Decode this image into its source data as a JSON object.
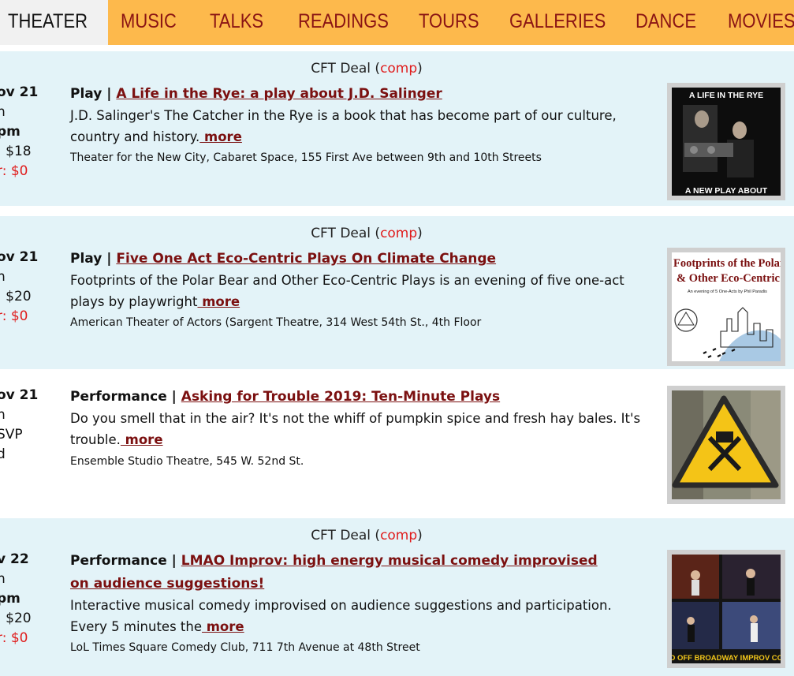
{
  "nav": {
    "tabs": [
      {
        "label": "THEATER",
        "active": true
      },
      {
        "label": "MUSIC"
      },
      {
        "label": "TALKS"
      },
      {
        "label": "READINGS"
      },
      {
        "label": "TOURS"
      },
      {
        "label": "GALLERIES"
      },
      {
        "label": "DANCE"
      },
      {
        "label": "MOVIES"
      }
    ]
  },
  "events": [
    {
      "deal_label": "CFT Deal (",
      "deal_comp": "comp",
      "deal_close": ")",
      "date": "ov 21",
      "line2": "n",
      "time": "pm",
      "price": ": $18",
      "member_price": "r: $0",
      "kind": "Play | ",
      "title": "A Life in the Rye: a play about J.D. Salinger",
      "desc": "J.D. Salinger's The Catcher in the Rye is a book that has become part of our culture, country and history.",
      "more": " more",
      "venue": "Theater for the New City, Cabaret Space, 155 First Ave between 9th and 10th Streets",
      "image_text_top": "A LIFE IN THE RYE",
      "image_text_bottom": "A NEW PLAY ABOUT"
    },
    {
      "deal_label": "CFT Deal (",
      "deal_comp": "comp",
      "deal_close": ")",
      "date": "ov 21",
      "line2": "n",
      "price": ": $20",
      "member_price": "r: $0",
      "kind": "Play | ",
      "title": "Five One Act Eco-Centric Plays On Climate Change",
      "desc": "Footprints of the Polar Bear and Other Eco-Centric Plays is an evening of five one-act plays by playwright",
      "more": " more",
      "venue": "American Theater of Actors (Sargent Theatre, 314 West 54th St., 4th Floor",
      "image_text_top": "Footprints of the Polar B",
      "image_text_mid": "& Other Eco-Centric Pl",
      "image_text_small": "An evening of 5 One-Acts by Phil Paradis"
    },
    {
      "date": "ov 21",
      "line2": "n",
      "line3": "SVP",
      "line4": "d",
      "kind": "Performance | ",
      "title": "Asking for Trouble 2019: Ten-Minute Plays",
      "desc": "Do you smell that in the air? It's not the whiff of pumpkin spice and fresh hay bales. It's trouble.",
      "more": " more",
      "venue": "Ensemble Studio Theatre, 545 W. 52nd St."
    },
    {
      "deal_label": "CFT Deal (",
      "deal_comp": "comp",
      "deal_close": ")",
      "date": "v 22",
      "line2": "n",
      "time": "pm",
      "price": ": $20",
      "member_price": "r: $0",
      "kind": "Performance | ",
      "title": "LMAO Improv: high energy musical comedy improvised on audience suggestions!",
      "desc": "Interactive musical comedy improvised on audience suggestions and participation. Every 5 minutes the",
      "more": " more",
      "venue": "LoL Times Square Comedy Club, 711 7th Avenue at 48th Street",
      "image_text_bottom": "O OFF BROADWAY IMPROV CO"
    }
  ]
}
